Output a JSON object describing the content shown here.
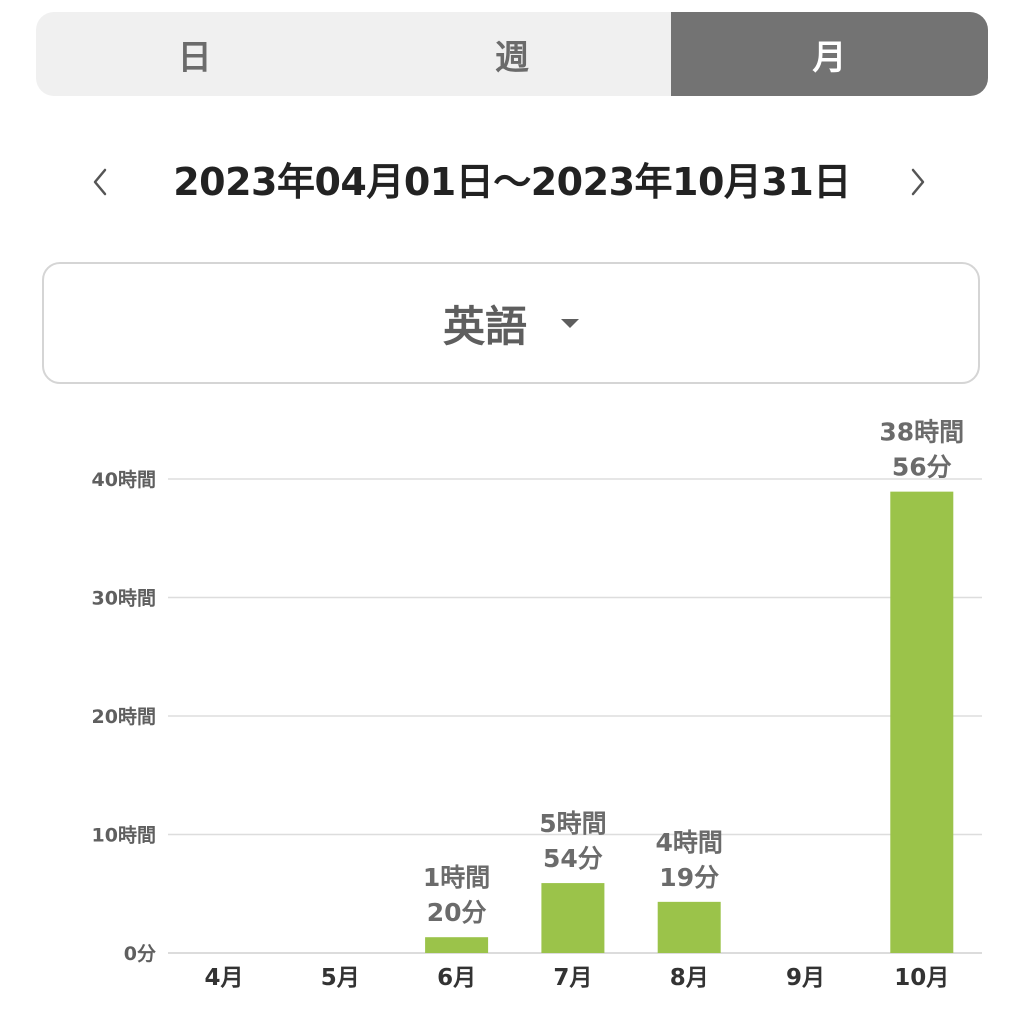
{
  "tabs": [
    {
      "label": "日",
      "active": false
    },
    {
      "label": "週",
      "active": false
    },
    {
      "label": "月",
      "active": true
    }
  ],
  "date_nav": {
    "range_label": "2023年04月01日〜2023年10月31日",
    "prev_icon": "chevron-left-icon",
    "next_icon": "chevron-right-icon"
  },
  "subject_select": {
    "selected": "英語",
    "icon": "caret-down-icon"
  },
  "colors": {
    "bar": "#9bc34a",
    "active_tab": "#737373",
    "grid": "#dddddd",
    "axis_text": "#5f5f5f",
    "label_text": "#6b6b6b"
  },
  "chart_data": {
    "type": "bar",
    "categories": [
      "4月",
      "5月",
      "6月",
      "7月",
      "8月",
      "9月",
      "10月"
    ],
    "values_minutes": [
      0,
      0,
      80,
      354,
      259,
      0,
      2336
    ],
    "data_labels": [
      null,
      null,
      [
        "1時間",
        "20分"
      ],
      [
        "5時間",
        "54分"
      ],
      [
        "4時間",
        "19分"
      ],
      null,
      [
        "38時間",
        "56分"
      ]
    ],
    "y_ticks_minutes": [
      0,
      600,
      1200,
      1800,
      2400
    ],
    "y_tick_labels": [
      "0分",
      "10時間",
      "20時間",
      "30時間",
      "40時間"
    ],
    "ylim_minutes": [
      0,
      2400
    ],
    "grid": true
  }
}
